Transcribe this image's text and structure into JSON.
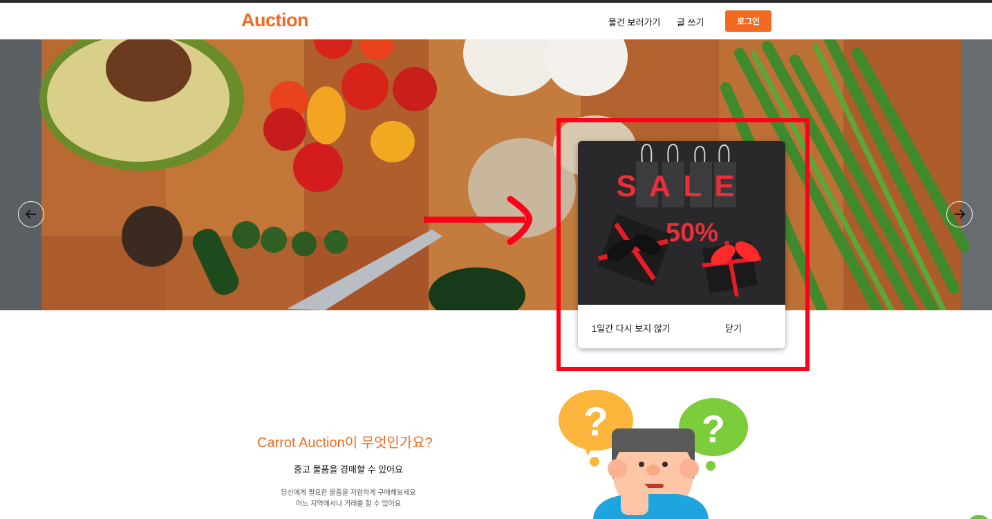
{
  "header": {
    "logo": "Auction",
    "nav": {
      "browse": "물건 보러가기",
      "write": "글 쓰기"
    },
    "login": "로그인"
  },
  "hero": {
    "prev_icon": "arrow-left-icon",
    "next_icon": "arrow-right-icon"
  },
  "popup": {
    "sale_text": "SALE",
    "discount": "50%",
    "dont_show": "1일간 다시 보지 않기",
    "close": "닫기"
  },
  "about": {
    "title": "Carrot Auction이 무엇인가요?",
    "subtitle": "중고 물품을 경매할 수 있어요",
    "desc_line1": "당신에게 필요한 물품을 저렴하게 구매해보세요",
    "desc_line2": "어느 지역에서나 거래를 할 수 있어요"
  },
  "colors": {
    "brand": "#f26a21",
    "annotation": "#ff0019"
  }
}
